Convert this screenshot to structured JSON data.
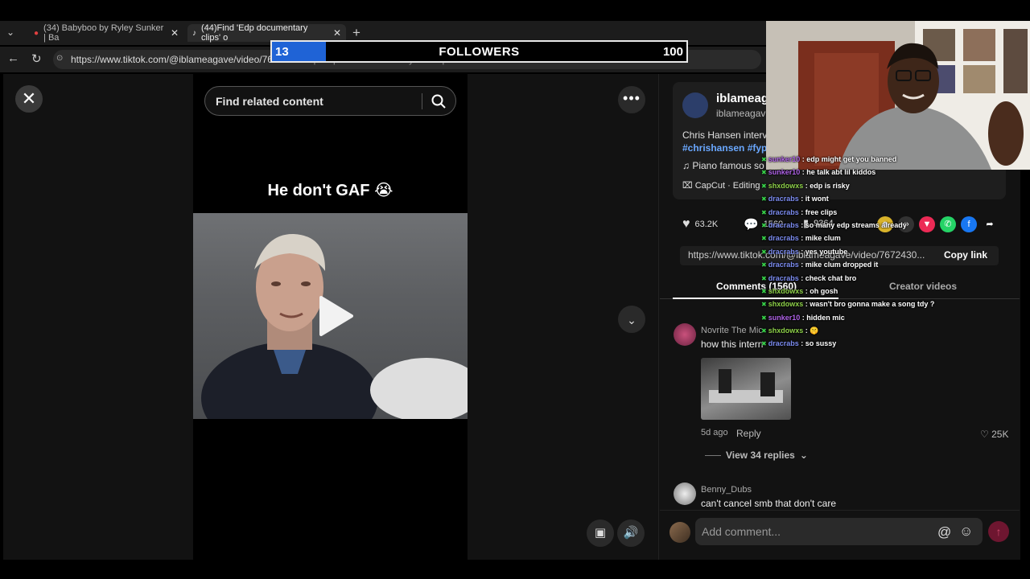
{
  "browser": {
    "tabs": [
      {
        "label": "(34) Babyboo by Ryley Sunker | Ba",
        "close": "✕"
      },
      {
        "label": "(44)Find 'Edp documentary clips' o",
        "close": "✕"
      }
    ],
    "new_tab": "+",
    "url_main": "https://www.tiktok.com/@iblameagave/video/76",
    "url_rest": "9886862q=Edp%20documentary%20clips&t=1786907586526"
  },
  "followers_goal": {
    "current": "13",
    "label": "FOLLOWERS",
    "max": "100",
    "progress": 0.13
  },
  "player": {
    "close": "✕",
    "search_placeholder": "Find related content",
    "more": "•••",
    "caption": "He don't GAF 😭",
    "down": "⌄"
  },
  "post": {
    "author_name": "iblameag",
    "author_handle": "iblameagav",
    "description": "Chris Hansen interv",
    "tags": "#chrishansen #fyp",
    "music": "♫  Piano famous so",
    "capcut": "CapCut · Editing"
  },
  "stats": {
    "likes": "63.2K",
    "comments": "1560",
    "saves": "9364"
  },
  "share": {
    "url": "https://www.tiktok.com/@iblameagave/video/7672430...",
    "copy_label": "Copy link"
  },
  "tabs": {
    "comments": "Comments (1560)",
    "creator": "Creator videos"
  },
  "comments": [
    {
      "name": "Novrite The Mic",
      "text": "how this intern",
      "time": "5d ago",
      "reply": "Reply",
      "likes": "25K",
      "view_replies": "View 34 replies"
    },
    {
      "name": "Benny_Dubs",
      "text": "can't cancel smb that don't care"
    }
  ],
  "comment_bar": {
    "placeholder": "Add comment...",
    "mention": "@",
    "emoji": "☺",
    "send": "↑"
  },
  "chat": [
    {
      "user": "sunker10",
      "color": "#b063e8",
      "msg": " : edp might get you banned"
    },
    {
      "user": "sunker10",
      "color": "#b063e8",
      "msg": " : he talk abt lil kiddos"
    },
    {
      "user": "shxdowxs",
      "color": "#8fd24a",
      "msg": " : edp is risky"
    },
    {
      "user": "dracrabs",
      "color": "#7c8cf0",
      "msg": " : it wont"
    },
    {
      "user": "dracrabs",
      "color": "#7c8cf0",
      "msg": " : free clips"
    },
    {
      "user": "dracrabs",
      "color": "#7c8cf0",
      "msg": " : so many edp streams already"
    },
    {
      "user": "dracrabs",
      "color": "#7c8cf0",
      "msg": " : mike clum"
    },
    {
      "user": "dracrabs",
      "color": "#7c8cf0",
      "msg": " : yes youtube"
    },
    {
      "user": "dracrabs",
      "color": "#7c8cf0",
      "msg": " : mike clum dropped it"
    },
    {
      "user": "dracrabs",
      "color": "#7c8cf0",
      "msg": " : check chat bro"
    },
    {
      "user": "shxdowxs",
      "color": "#8fd24a",
      "msg": " : oh gosh"
    },
    {
      "user": "shxdowxs",
      "color": "#8fd24a",
      "msg": " : wasn't bro gonna make a song tdy ?"
    },
    {
      "user": "sunker10",
      "color": "#b063e8",
      "msg": " : hidden mic"
    },
    {
      "user": "shxdowxs",
      "color": "#8fd24a",
      "msg": " : 🤫"
    },
    {
      "user": "dracrabs",
      "color": "#7c8cf0",
      "msg": " : so sussy"
    }
  ]
}
